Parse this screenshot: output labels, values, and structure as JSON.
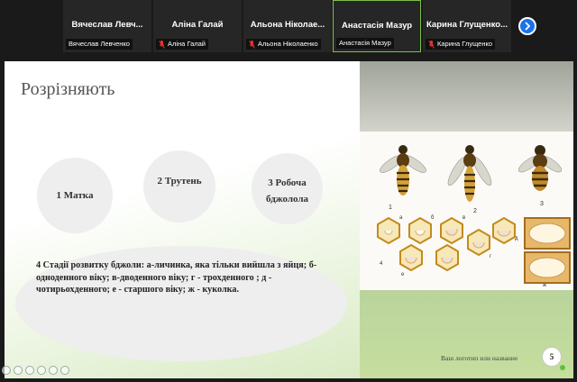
{
  "participants": [
    {
      "name": "Вячеслав Левч...",
      "label": "Вячеслав Левченко",
      "muted": false,
      "active": false
    },
    {
      "name": "Аліна Галай",
      "label": "Аліна Галай",
      "muted": true,
      "active": false
    },
    {
      "name": "Альона Ніколае...",
      "label": "Альона Ніколаенко",
      "muted": true,
      "active": false
    },
    {
      "name": "Анастасія Мазур",
      "label": "Анастасія Мазур",
      "muted": false,
      "active": true
    },
    {
      "name": "Карина Глущенко...",
      "label": "Карина Глущенко",
      "muted": true,
      "active": false
    }
  ],
  "slide": {
    "title": "Розрізняють",
    "circle1": "1 Матка",
    "circle2": "2 Трутень",
    "circle3": "3 Робоча бджолола",
    "stages": "4 Стадії розвитку бджоли: а-личинка, яка тільки вийшла з яйця; б-одноденного віку; в-дводенного віку; г - трохденного ; д - чотирьохденного; е - старшого віку; ж - куколка.",
    "figure_labels": [
      "1",
      "2",
      "3",
      "а",
      "б",
      "в",
      "г",
      "д",
      "е",
      "ж",
      "4"
    ],
    "footer": "Ваш логотип или название",
    "page": "5"
  },
  "colors": {
    "accent": "#1a73e8",
    "active_border": "#7cc04b",
    "muted_icon": "#e5342c"
  }
}
